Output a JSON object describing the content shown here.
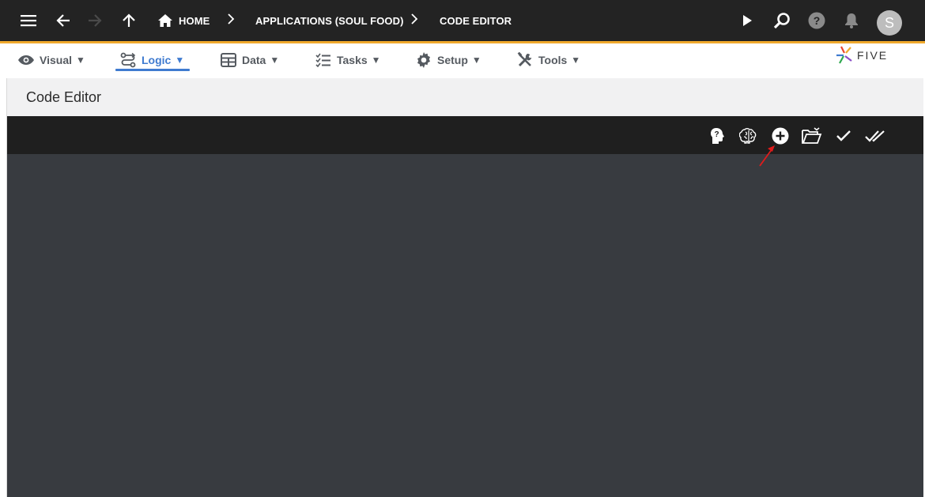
{
  "appbar": {
    "breadcrumbs": [
      {
        "label": "HOME"
      },
      {
        "label": "APPLICATIONS (SOUL FOOD)"
      },
      {
        "label": "CODE EDITOR"
      }
    ],
    "avatar_initial": "S",
    "accent_color": "#f0a92d",
    "icons": [
      "menu-icon",
      "back-arrow-icon",
      "forward-arrow-icon",
      "up-arrow-icon",
      "home-icon",
      "play-icon",
      "search-icon",
      "help-icon",
      "bell-icon"
    ]
  },
  "menubar": {
    "items": [
      {
        "label": "Visual",
        "caret": "▼",
        "icon": "eye-icon"
      },
      {
        "label": "Logic",
        "caret": "▼",
        "icon": "logic-icon",
        "active": true
      },
      {
        "label": "Data",
        "caret": "▼",
        "icon": "table-icon"
      },
      {
        "label": "Tasks",
        "caret": "▼",
        "icon": "checklist-icon"
      },
      {
        "label": "Setup",
        "caret": "▼",
        "icon": "gear-icon"
      },
      {
        "label": "Tools",
        "caret": "▼",
        "icon": "tools-icon"
      }
    ],
    "active_color": "#3f7bd0",
    "logo_text": "FIVE"
  },
  "page": {
    "title": "Code Editor"
  },
  "editor_toolbar": {
    "buttons": [
      "help-head-icon",
      "brain-icon",
      "add-circle-icon",
      "open-folder-icon",
      "check-icon",
      "double-check-icon"
    ]
  }
}
